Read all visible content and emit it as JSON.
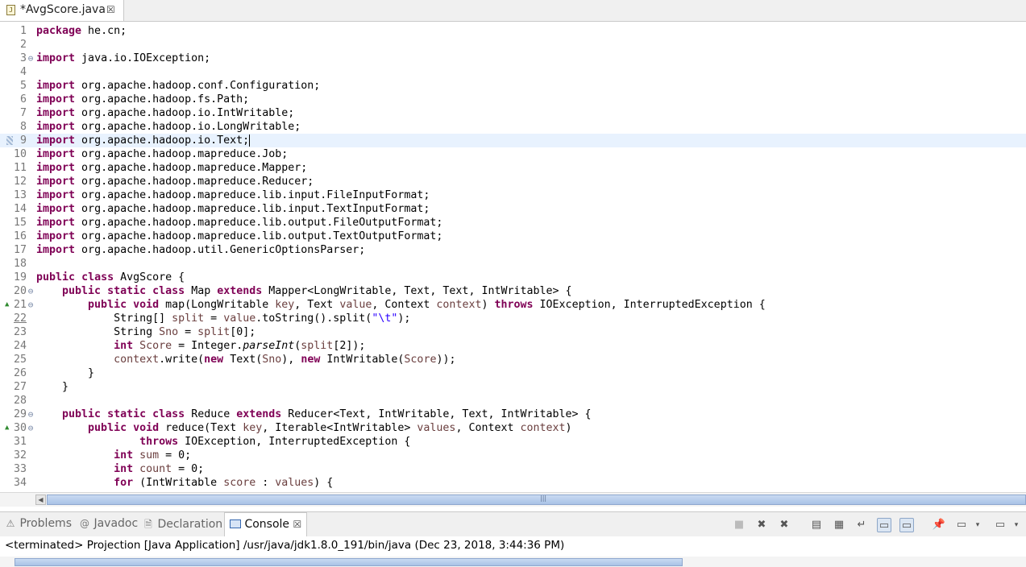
{
  "editor": {
    "tab_title": "*AvgScore.java",
    "tab_close": "☒",
    "file_icon": "J",
    "current_line": 9,
    "lines": [
      {
        "n": "1",
        "html": "<span class='kw'>package</span> he.cn;"
      },
      {
        "n": "2",
        "html": ""
      },
      {
        "n": "3",
        "fold": "minus",
        "html": "<span class='kw'>import</span> java.io.IOException;"
      },
      {
        "n": "4",
        "html": ""
      },
      {
        "n": "5",
        "html": "<span class='kw'>import</span> org.apache.hadoop.conf.Configuration;"
      },
      {
        "n": "6",
        "html": "<span class='kw'>import</span> org.apache.hadoop.fs.Path;"
      },
      {
        "n": "7",
        "html": "<span class='kw'>import</span> org.apache.hadoop.io.IntWritable;"
      },
      {
        "n": "8",
        "html": "<span class='kw'>import</span> org.apache.hadoop.io.LongWritable;"
      },
      {
        "n": "9",
        "bookmark": true,
        "html": "<span class='kw'>import</span> org.apache.hadoop.io.Text;"
      },
      {
        "n": "10",
        "html": "<span class='kw'>import</span> org.apache.hadoop.mapreduce.Job;"
      },
      {
        "n": "11",
        "html": "<span class='kw'>import</span> org.apache.hadoop.mapreduce.Mapper;"
      },
      {
        "n": "12",
        "html": "<span class='kw'>import</span> org.apache.hadoop.mapreduce.Reducer;"
      },
      {
        "n": "13",
        "html": "<span class='kw'>import</span> org.apache.hadoop.mapreduce.lib.input.FileInputFormat;"
      },
      {
        "n": "14",
        "html": "<span class='kw'>import</span> org.apache.hadoop.mapreduce.lib.input.TextInputFormat;"
      },
      {
        "n": "15",
        "html": "<span class='kw'>import</span> org.apache.hadoop.mapreduce.lib.output.FileOutputFormat;"
      },
      {
        "n": "16",
        "html": "<span class='kw'>import</span> org.apache.hadoop.mapreduce.lib.output.TextOutputFormat;"
      },
      {
        "n": "17",
        "html": "<span class='kw'>import</span> org.apache.hadoop.util.GenericOptionsParser;"
      },
      {
        "n": "18",
        "html": ""
      },
      {
        "n": "19",
        "html": "<span class='kw'>public</span> <span class='kw'>class</span> AvgScore {"
      },
      {
        "n": "20",
        "fold": "minus",
        "html": "    <span class='kw'>public</span> <span class='kw'>static</span> <span class='kw'>class</span> Map <span class='kw'>extends</span> Mapper&lt;LongWritable, Text, Text, IntWritable&gt; {"
      },
      {
        "n": "21",
        "fold": "minus",
        "override": true,
        "html": "        <span class='kw'>public</span> <span class='kw'>void</span> map(LongWritable <span class='fld'>key</span>, Text <span class='fld'>value</span>, Context <span class='fld'>context</span>) <span class='kw'>throws</span> IOException, InterruptedException {"
      },
      {
        "n": "22",
        "underline": true,
        "html": "            String[] <span class='fld'>split</span> = <span class='fld'>value</span>.toString().split(<span class='str'>\"\\t\"</span>);"
      },
      {
        "n": "23",
        "html": "            String <span class='fld'>Sno</span> = <span class='fld'>split</span>[0];"
      },
      {
        "n": "24",
        "html": "            <span class='kw'>int</span> <span class='fld'>Score</span> = Integer.<span class='it'>parseInt</span>(<span class='fld'>split</span>[2]);"
      },
      {
        "n": "25",
        "html": "            <span class='fld'>context</span>.write(<span class='kw'>new</span> Text(<span class='fld'>Sno</span>), <span class='kw'>new</span> IntWritable(<span class='fld'>Score</span>));"
      },
      {
        "n": "26",
        "html": "        }"
      },
      {
        "n": "27",
        "html": "    }"
      },
      {
        "n": "28",
        "html": ""
      },
      {
        "n": "29",
        "fold": "minus",
        "html": "    <span class='kw'>public</span> <span class='kw'>static</span> <span class='kw'>class</span> Reduce <span class='kw'>extends</span> Reducer&lt;Text, IntWritable, Text, IntWritable&gt; {"
      },
      {
        "n": "30",
        "fold": "minus",
        "override": true,
        "html": "        <span class='kw'>public</span> <span class='kw'>void</span> reduce(Text <span class='fld'>key</span>, Iterable&lt;IntWritable&gt; <span class='fld'>values</span>, Context <span class='fld'>context</span>)"
      },
      {
        "n": "31",
        "html": "                <span class='kw'>throws</span> IOException, InterruptedException {"
      },
      {
        "n": "32",
        "html": "            <span class='kw'>int</span> <span class='fld'>sum</span> = 0;"
      },
      {
        "n": "33",
        "html": "            <span class='kw'>int</span> <span class='fld'>count</span> = 0;"
      },
      {
        "n": "34",
        "html": "            <span class='kw'>for</span> (IntWritable <span class='fld'>score</span> : <span class='fld'>values</span>) {"
      }
    ]
  },
  "views": {
    "tabs": [
      {
        "id": "problems",
        "label": "Problems",
        "icon": "warning-icon",
        "glyph": "⚠"
      },
      {
        "id": "javadoc",
        "label": "Javadoc",
        "icon": "at-icon",
        "glyph": "@"
      },
      {
        "id": "declaration",
        "label": "Declaration",
        "icon": "declaration-icon",
        "glyph": "🗎"
      },
      {
        "id": "console",
        "label": "Console",
        "icon": "console-icon",
        "active": true,
        "close": "☒"
      }
    ],
    "toolbar": [
      {
        "name": "terminate-button",
        "glyph": "■"
      },
      {
        "name": "remove-launch-button",
        "glyph": "✖"
      },
      {
        "name": "remove-all-terminated-button",
        "glyph": "✖"
      },
      {
        "name": "clear-console-button",
        "glyph": "▤"
      },
      {
        "name": "scroll-lock-button",
        "glyph": "▦"
      },
      {
        "name": "word-wrap-button",
        "glyph": "↵"
      },
      {
        "name": "show-on-stdout-button",
        "glyph": "▭",
        "pressed": true
      },
      {
        "name": "show-on-stderr-button",
        "glyph": "▭",
        "pressed": true
      },
      {
        "name": "pin-console-button",
        "glyph": "📌"
      },
      {
        "name": "display-console-button",
        "glyph": "▭"
      },
      {
        "name": "display-console-menu",
        "glyph": "▾"
      },
      {
        "name": "open-console-button",
        "glyph": "▭"
      },
      {
        "name": "view-menu-button",
        "glyph": "▾"
      }
    ]
  },
  "console": {
    "status": "<terminated> Projection [Java Application] /usr/java/jdk1.8.0_191/bin/java (Dec 23, 2018, 3:44:36 PM)"
  },
  "colors": {
    "keyword": "#7f0055",
    "field": "#6a3e3e",
    "string": "#2a00ff",
    "current_line": "#e8f2fe",
    "scroll_thumb": "#a9c2e6"
  }
}
